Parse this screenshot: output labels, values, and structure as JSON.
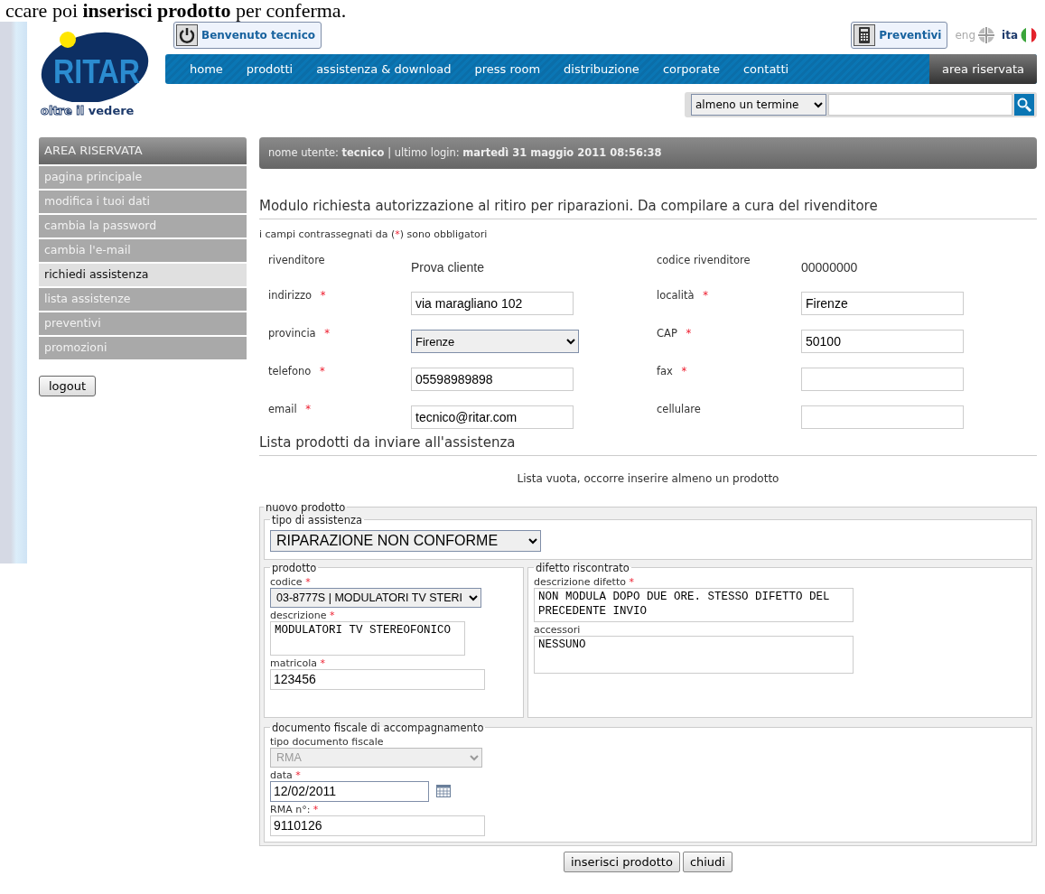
{
  "document_text": "ccare poi **inserisci prodotto** per conferma.",
  "header": {
    "logo": {
      "name": "RITAR",
      "tagline_light": "oltre il",
      "tagline_bold": "vedere"
    },
    "welcome_button": "Benvenuto tecnico",
    "quotes_button": "Preventivi",
    "languages": [
      {
        "label": "eng",
        "selected": false
      },
      {
        "label": "ita",
        "selected": true
      }
    ],
    "nav": [
      {
        "label": "home",
        "selected": false
      },
      {
        "label": "prodotti",
        "selected": false
      },
      {
        "label": "assistenza & download",
        "selected": false
      },
      {
        "label": "press room",
        "selected": false
      },
      {
        "label": "distribuzione",
        "selected": false
      },
      {
        "label": "corporate",
        "selected": false
      },
      {
        "label": "contatti",
        "selected": false
      },
      {
        "label": "area riservata",
        "selected": true
      }
    ],
    "search": {
      "mode": "almeno un termine"
    }
  },
  "sidebar": {
    "title": "AREA RISERVATA",
    "items": [
      {
        "label": "pagina principale",
        "selected": false
      },
      {
        "label": "modifica i tuoi dati",
        "selected": false
      },
      {
        "label": "cambia la password",
        "selected": false
      },
      {
        "label": "cambia l'e-mail",
        "selected": false
      },
      {
        "label": "richiedi assistenza",
        "selected": true
      },
      {
        "label": "lista assistenze",
        "selected": false
      },
      {
        "label": "preventivi",
        "selected": false
      },
      {
        "label": "promozioni",
        "selected": false
      }
    ],
    "logout": "logout"
  },
  "user_bar": "nome utente: **tecnico** | ultimo login: **martedì 31 maggio 2011 08:56:38**",
  "form": {
    "title": "Modulo richiesta autorizzazione al ritiro per riparazioni. Da compilare a cura del rivenditore",
    "note": {
      "before": "i campi contrassegnati da (",
      "mark": "*",
      "after": ") sono obbligatori"
    },
    "rows": [
      [
        {
          "label": "rivenditore",
          "kind": "static",
          "value": "Prova cliente"
        },
        {
          "label": "codice rivenditore",
          "kind": "static",
          "value": "00000000"
        }
      ],
      [
        {
          "label": "indirizzo",
          "mark": "*",
          "kind": "text",
          "value": "via maragliano 102"
        },
        {
          "label": "località",
          "mark": "*",
          "kind": "text",
          "value": "Firenze"
        }
      ],
      [
        {
          "label": "provincia",
          "mark": "*",
          "kind": "select",
          "value": "Firenze"
        },
        {
          "label": "CAP",
          "mark": "*",
          "kind": "text",
          "value": "50100"
        }
      ],
      [
        {
          "label": "telefono",
          "mark": "*",
          "kind": "text",
          "value": "05598989898"
        },
        {
          "label": "fax",
          "mark": "*",
          "kind": "text"
        }
      ],
      [
        {
          "label": "email",
          "mark": "*",
          "kind": "text",
          "value": "tecnico@ritar.com"
        },
        {
          "label": "cellulare",
          "kind": "text"
        }
      ]
    ]
  },
  "products": {
    "title": "Lista prodotti da inviare all'assistenza",
    "empty_message": "Lista vuota, occorre inserire almeno un prodotto",
    "new_product": {
      "legend": "nuovo prodotto",
      "assistance_type": {
        "legend": "tipo di assistenza",
        "value": "RIPARAZIONE NON CONFORME"
      },
      "product": {
        "legend": "prodotto",
        "fields": [
          {
            "label": "codice",
            "mark": "*",
            "kind": "select",
            "value": "03-8777S | MODULATORI TV STERI"
          },
          {
            "label": "descrizione",
            "mark": "*",
            "kind": "textarea",
            "value": "MODULATORI TV STEREOFONICO"
          },
          {
            "label": "matricola",
            "mark": "*",
            "kind": "text",
            "value": "123456"
          }
        ]
      },
      "defect": {
        "legend": "difetto riscontrato",
        "fields": [
          {
            "label": "descrizione difetto",
            "mark": "*",
            "kind": "textarea",
            "value": "NON MODULA DOPO DUE ORE. STESSO DIFETTO DEL PRECEDENTE INVIO"
          },
          {
            "label": "accessori",
            "kind": "textarea",
            "value": "NESSUNO"
          }
        ]
      },
      "document": {
        "legend": "documento fiscale di accompagnamento",
        "fields": [
          {
            "label": "tipo documento fiscale",
            "kind": "select",
            "value": "RMA",
            "disabled": true
          },
          {
            "label": "data",
            "mark": "*",
            "kind": "date",
            "value": "12/02/2011"
          },
          {
            "label": "RMA n°:",
            "mark": "*",
            "kind": "text",
            "value": "9110126"
          }
        ]
      }
    },
    "buttons": [
      "inserisci prodotto",
      "chiudi"
    ]
  }
}
